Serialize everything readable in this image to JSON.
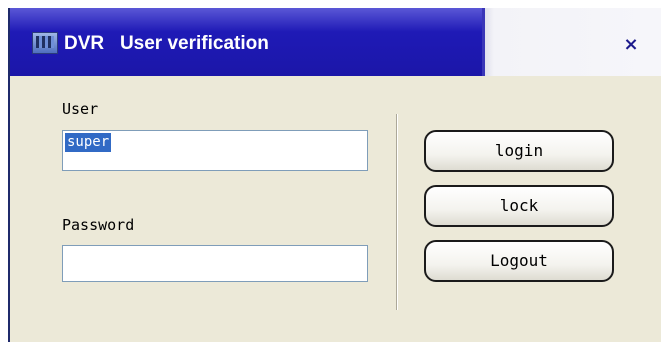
{
  "window": {
    "title": "DVR   User verification",
    "close_label": "×"
  },
  "form": {
    "user_label": "User",
    "user_value": "super",
    "password_label": "Password",
    "password_value": ""
  },
  "buttons": {
    "login": "login",
    "lock": "lock",
    "logout": "Logout"
  }
}
